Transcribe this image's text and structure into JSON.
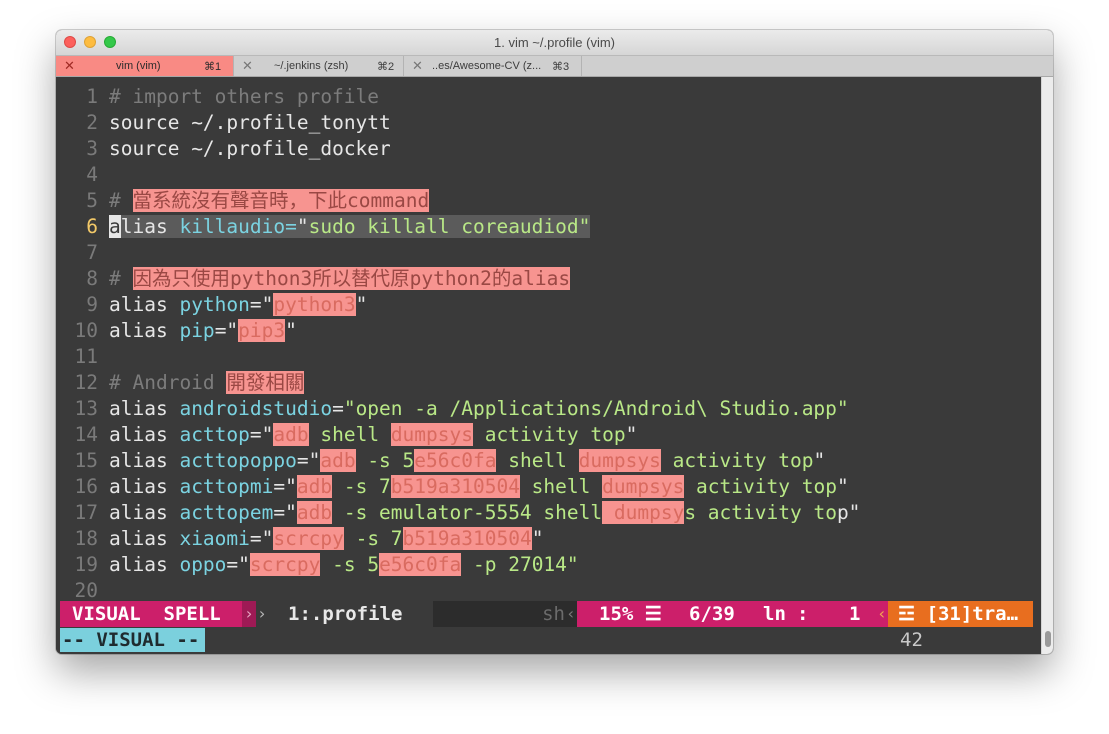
{
  "window": {
    "title": "1. vim ~/.profile (vim)"
  },
  "tabs": [
    {
      "label": "vim (vim)",
      "shortcut": "⌘1",
      "active": true
    },
    {
      "label": "~/.jenkins (zsh)",
      "shortcut": "⌘2",
      "active": false
    },
    {
      "label": "..es/Awesome-CV (z...",
      "shortcut": "⌘3",
      "active": false
    }
  ],
  "editor": {
    "current_line": 6,
    "lines": [
      {
        "n": "1",
        "text": "# import others profile"
      },
      {
        "n": "2",
        "text": "source ~/.profile_tonytt"
      },
      {
        "n": "3",
        "text": "source ~/.profile_docker"
      },
      {
        "n": "4",
        "text": ""
      },
      {
        "n": "5",
        "text": "# 當系統沒有聲音時，下此command"
      },
      {
        "n": "6",
        "text": "alias killaudio=\"sudo killall coreaudiod\""
      },
      {
        "n": "7",
        "text": ""
      },
      {
        "n": "8",
        "text": "# 因為只使用python3所以替代原python2的alias"
      },
      {
        "n": "9",
        "text": "alias python=\"python3\""
      },
      {
        "n": "10",
        "text": "alias pip=\"pip3\""
      },
      {
        "n": "11",
        "text": ""
      },
      {
        "n": "12",
        "text": "# Android 開發相關"
      },
      {
        "n": "13",
        "text": "alias androidstudio=\"open -a /Applications/Android\\ Studio.app\""
      },
      {
        "n": "14",
        "text": "alias acttop=\"adb shell dumpsys activity top\""
      },
      {
        "n": "15",
        "text": "alias acttopoppo=\"adb -s 5e56c0fa shell dumpsys activity top\""
      },
      {
        "n": "16",
        "text": "alias acttopmi=\"adb -s 7b519a310504 shell dumpsys activity top\""
      },
      {
        "n": "17",
        "text": "alias acttopem=\"adb -s emulator-5554 shell dumpsys activity top\""
      },
      {
        "n": "18",
        "text": "alias xiaomi=\"scrcpy -s 7b519a310504\""
      },
      {
        "n": "19",
        "text": "alias oppo=\"scrcpy -s 5e56c0fa -p 27014\""
      },
      {
        "n": "20",
        "text": ""
      }
    ]
  },
  "statusline": {
    "mode": "VISUAL",
    "spell": "SPELL",
    "sep_right": "›",
    "file": "1:.profile",
    "filetype": "sh",
    "sep_left": "‹",
    "percent": "15%",
    "percent_icon": "☰",
    "position": "6/39",
    "ln": "ln",
    "colon": ":",
    "col": "1",
    "warning_icon": "☲",
    "warning": "[31]tra…"
  },
  "cmdline": {
    "mode": "-- VISUAL --",
    "count": "42"
  },
  "colors": {
    "mode_bg": "#cc1f6a",
    "warning_bg": "#e86e1f",
    "cmd_mode_bg": "#7bd0dd",
    "spell_bg": "#f79490",
    "active_tab_bg": "#f98a84"
  }
}
